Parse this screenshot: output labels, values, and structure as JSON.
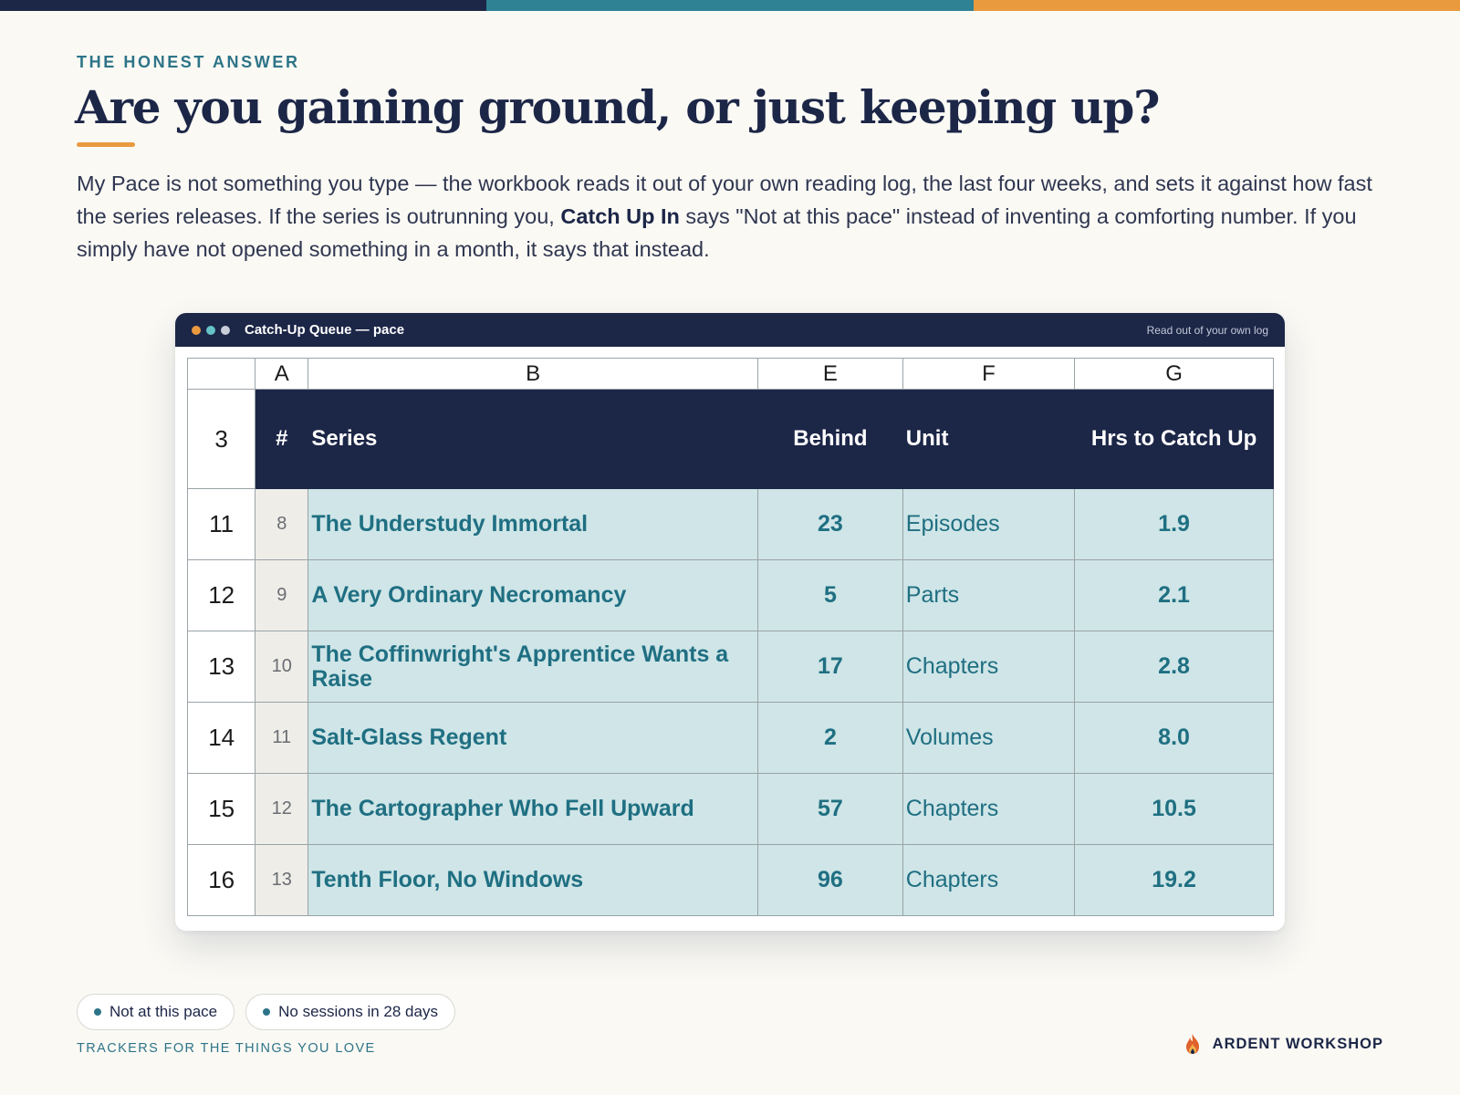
{
  "accent_colors": {
    "navy": "#1c2647",
    "teal": "#2e8294",
    "orange": "#e99a3f",
    "cell_fill": "#cfe5e7"
  },
  "eyebrow": "THE HONEST ANSWER",
  "headline": "Are you gaining ground, or just keeping up?",
  "lede": {
    "part1": "My Pace is not something you type — the workbook reads it out of your own reading log, the last four weeks, and sets it against how fast the series releases. If the series is outrunning you, ",
    "bold": "Catch Up In",
    "part2": " says \"Not at this pace\" instead of inventing a comforting number. If you simply have not opened something in a month, it says that instead."
  },
  "window": {
    "title": "Catch-Up Queue — pace",
    "note": "Read out of your own log",
    "column_letters": [
      "A",
      "B",
      "E",
      "F",
      "G"
    ],
    "header_row_number": "3",
    "headers": {
      "num": "#",
      "series": "Series",
      "behind": "Behind",
      "unit": "Unit",
      "hours": "Hrs to Catch Up"
    },
    "rows": [
      {
        "row": "11",
        "num": "8",
        "series": "The Understudy Immortal",
        "behind": "23",
        "unit": "Episodes",
        "hours": "1.9"
      },
      {
        "row": "12",
        "num": "9",
        "series": "A Very Ordinary Necromancy",
        "behind": "5",
        "unit": "Parts",
        "hours": "2.1"
      },
      {
        "row": "13",
        "num": "10",
        "series": "The Coffinwright's Apprentice Wants a Raise",
        "behind": "17",
        "unit": "Chapters",
        "hours": "2.8"
      },
      {
        "row": "14",
        "num": "11",
        "series": "Salt-Glass Regent",
        "behind": "2",
        "unit": "Volumes",
        "hours": "8.0"
      },
      {
        "row": "15",
        "num": "12",
        "series": "The Cartographer Who Fell Upward",
        "behind": "57",
        "unit": "Chapters",
        "hours": "10.5"
      },
      {
        "row": "16",
        "num": "13",
        "series": "Tenth Floor, No Windows",
        "behind": "96",
        "unit": "Chapters",
        "hours": "19.2"
      }
    ]
  },
  "pills": [
    "Not at this pace",
    "No sessions in 28 days"
  ],
  "footer": {
    "tagline": "TRACKERS FOR THE THINGS YOU LOVE",
    "brand": "ARDENT WORKSHOP",
    "brand_icon": "flame-icon"
  }
}
